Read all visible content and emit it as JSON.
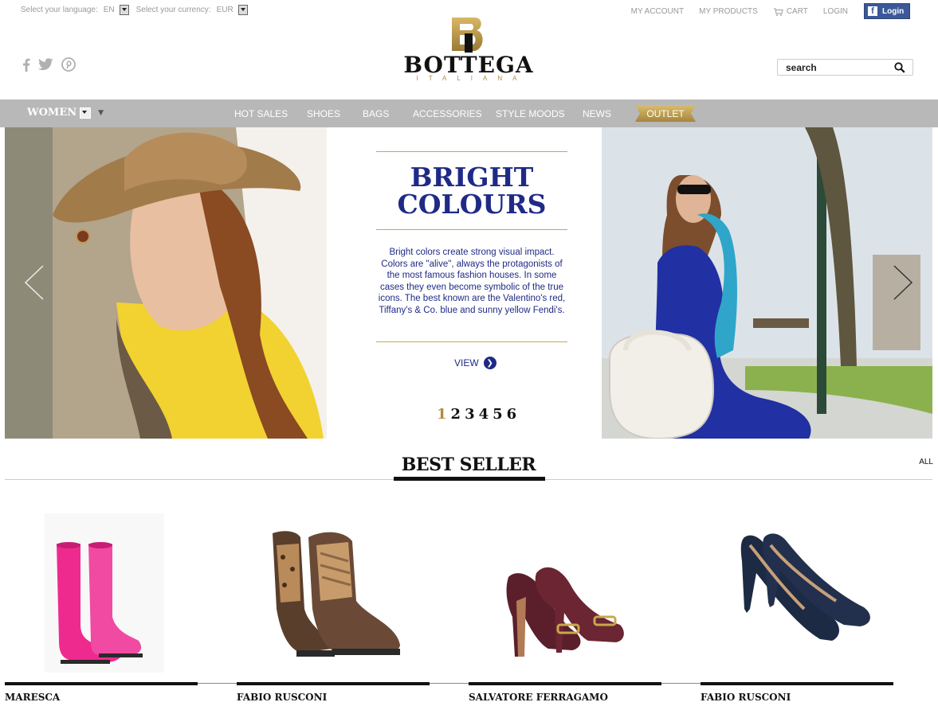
{
  "topbar": {
    "language_label": "Select your language:",
    "language_value": "EN",
    "currency_label": "Select your currency:",
    "currency_value": "EUR",
    "links": {
      "my_account": "MY ACCOUNT",
      "my_products": "MY PRODUCTS",
      "cart": "CART",
      "login": "LOGIN"
    },
    "facebook_login": "Login"
  },
  "logo": {
    "word": "BOTTEGA",
    "sub": "ITALIANA"
  },
  "search": {
    "placeholder": "search"
  },
  "nav": {
    "women": "WOMEN",
    "items": [
      "HOT SALES",
      "SHOES",
      "BAGS",
      "ACCESSORIES",
      "STYLE MOODS",
      "NEWS"
    ],
    "outlet": "OUTLET"
  },
  "hero": {
    "title_line1": "BRIGHT",
    "title_line2": "COLOURS",
    "text": "Bright colors create strong visual impact. Colors are \"alive\", always the protagonists of the most famous fashion houses. In some cases they even become symbolic of the true icons. The best known are the Valentino's red, Tiffany's & Co. blue and sunny yellow Fendi's.",
    "view_label": "VIEW",
    "pages": [
      "1",
      "2",
      "3",
      "4",
      "5",
      "6"
    ],
    "active_page": 1
  },
  "best_seller": {
    "title": "BEST SELLER",
    "all_link": "ALL",
    "products": [
      {
        "brand": "MARESCA",
        "item": "pink rubber boots"
      },
      {
        "brand": "FABIO RUSCONI",
        "item": "leopard lace-up ankle boots"
      },
      {
        "brand": "SALVATORE FERRAGAMO",
        "item": "burgundy leather pumps"
      },
      {
        "brand": "FABIO RUSCONI",
        "item": "navy suede pumps"
      }
    ]
  },
  "colors": {
    "nav_bg": "#b8b8b8",
    "hero_blue": "#1f2a86",
    "gold": "#b08d3f",
    "facebook": "#3b5998"
  }
}
